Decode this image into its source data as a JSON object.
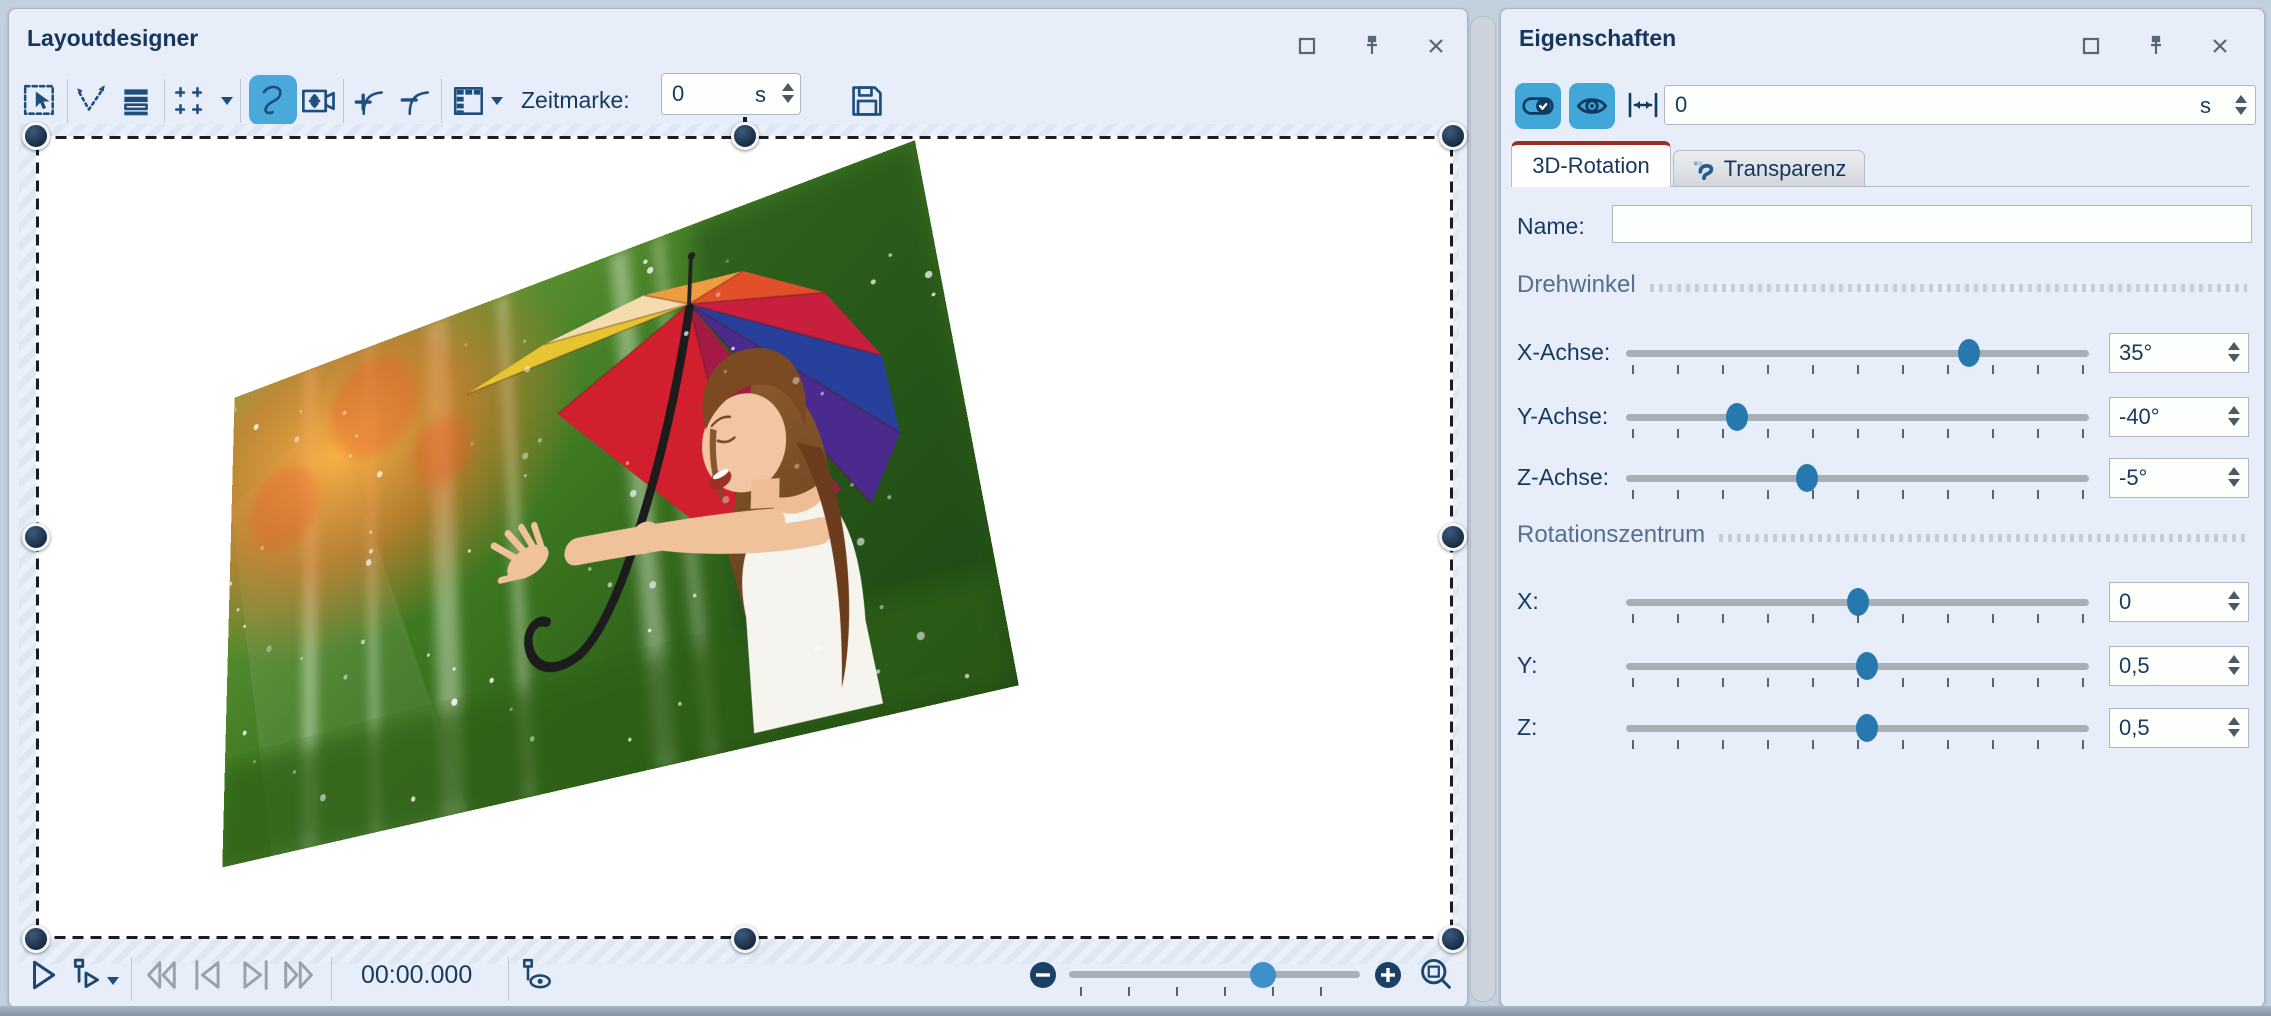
{
  "left_panel": {
    "title": "Layoutdesigner",
    "toolbar": {
      "zeitmarke_label": "Zeitmarke:",
      "zeitmarke_value": "0",
      "zeitmarke_unit": "s",
      "tools": [
        "select",
        "path-points",
        "layers",
        "grid",
        "curve",
        "camera-pan",
        "keyframe-add",
        "keyframe-remove",
        "table",
        "save"
      ],
      "active_tool": "curve"
    },
    "canvas": {
      "object_type": "photo",
      "description": "woman with rainbow umbrella in rain, 3D-rotated"
    },
    "transport": {
      "time": "00:00.000",
      "zoom_percent": 66.5
    }
  },
  "right_panel": {
    "title": "Eigenschaften",
    "header": {
      "time_value": "0",
      "time_unit": "s"
    },
    "tabs": [
      {
        "label": "3D-Rotation",
        "active": true
      },
      {
        "label": "Transparenz",
        "active": false
      }
    ],
    "name_label": "Name:",
    "name_value": "",
    "sections": [
      {
        "title": "Drehwinkel",
        "sliders": [
          {
            "label": "X-Achse:",
            "value": "35°",
            "percent": 74
          },
          {
            "label": "Y-Achse:",
            "value": "-40°",
            "percent": 24
          },
          {
            "label": "Z-Achse:",
            "value": "-5°",
            "percent": 39
          }
        ]
      },
      {
        "title": "Rotationszentrum",
        "sliders": [
          {
            "label": "X:",
            "value": "0",
            "percent": 50
          },
          {
            "label": "Y:",
            "value": "0,5",
            "percent": 52
          },
          {
            "label": "Z:",
            "value": "0,5",
            "percent": 52
          }
        ]
      }
    ]
  },
  "colors": {
    "accent_blue": "#41a6d8",
    "slider_handle": "#2878b0",
    "navy": "#17395e",
    "tab_top": "#9b2d22"
  }
}
